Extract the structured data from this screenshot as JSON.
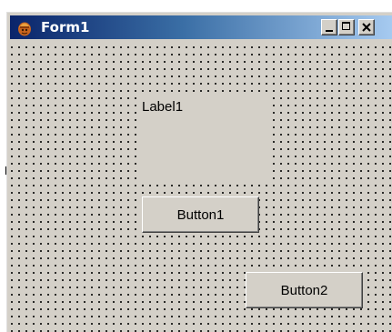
{
  "window": {
    "title": "Form1",
    "icon": "app-icon"
  },
  "caption_buttons": {
    "minimize": "minimize-icon",
    "maximize": "maximize-icon",
    "close": "close-icon"
  },
  "form": {
    "label1": "Label1",
    "button1": "Button1",
    "button2": "Button2"
  },
  "colors": {
    "face": "#d4d0c8",
    "titlebar_start": "#0a246a",
    "titlebar_end": "#a6caf0",
    "grid_dot": "#000000"
  }
}
